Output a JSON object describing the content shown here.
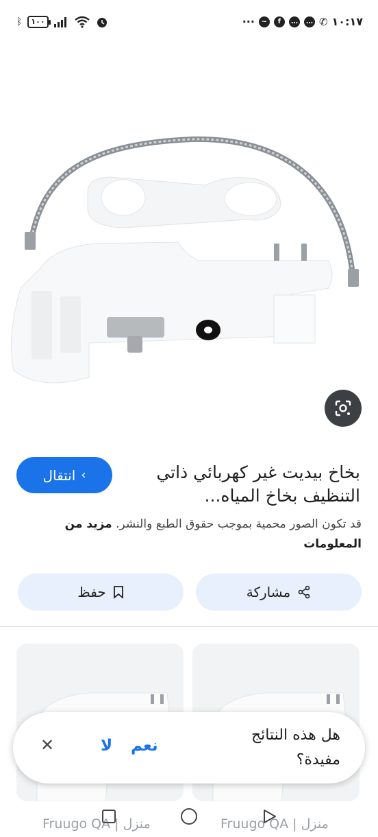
{
  "status_bar": {
    "time": "١٠:١٧",
    "battery": "١٠٠",
    "overflow": "···"
  },
  "result": {
    "title": "بخاخ بيديت غير كهربائي ذاتي التنظيف بخاخ المياه...",
    "visit_label": "انتقال",
    "copyright_text": "قد تكون الصور محمية بموجب حقوق الطبع والنشر.",
    "more_info": "مزيد من المعلومات",
    "share_label": "مشاركة",
    "save_label": "حفظ"
  },
  "related": [
    {
      "source": "Fruugo QA | منزل"
    },
    {
      "source": "Fruugo QA | منزل"
    }
  ],
  "feedback": {
    "question": "هل هذه النتائج مفيدة؟",
    "yes_label": "نعم",
    "no_label": "لا",
    "close_icon": "close-icon"
  },
  "colors": {
    "accent": "#1a73e8",
    "pill_bg": "#e8f0fe",
    "lens_bg": "#3c4043"
  }
}
